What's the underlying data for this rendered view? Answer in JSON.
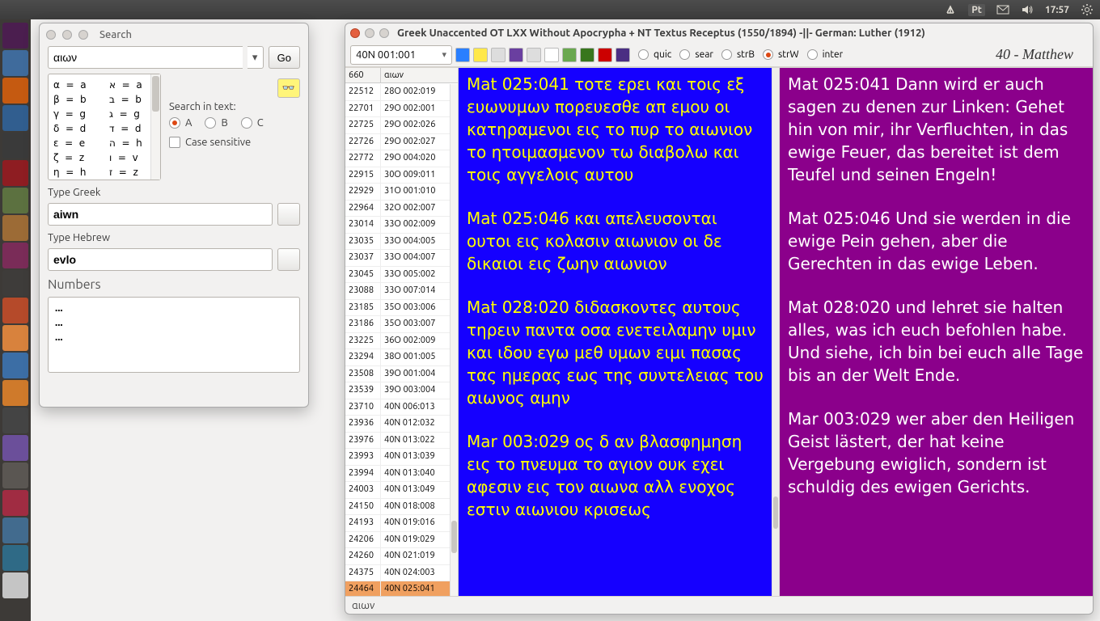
{
  "menubar": {
    "pt": "Pt",
    "time": "17:57"
  },
  "search_window": {
    "title": "Search",
    "query": "αιων",
    "go": "Go",
    "letters_left": "α  =  a\nβ  =  b\nγ  =  g\nδ  =  d\nε  =  e\nζ  =  z\nη  =  h",
    "letters_right": "א  =  a\nב  =  b\nג  =  g\nד  =  d\nה  =  h\nו  =  v\nז  =  z",
    "search_in_text": "Search in text:",
    "radio_a": "A",
    "radio_b": "B",
    "radio_c": "C",
    "case_sensitive": "Case sensitive",
    "type_greek": "Type Greek",
    "greek_value": "aiwn",
    "type_hebrew": "Type Hebrew",
    "hebrew_value": "evlo",
    "numbers_label": "Numbers",
    "numbers": [
      "...",
      "...",
      "..."
    ]
  },
  "main_window": {
    "title": "Greek Unaccented OT LXX Without Apocrypha + NT Textus Receptus (1550/1894)   -||-   German: Luther (1912)",
    "verse_selector": "40N 001:001",
    "radios": [
      {
        "label": "quic",
        "sel": false
      },
      {
        "label": "sear",
        "sel": false
      },
      {
        "label": "strB",
        "sel": false
      },
      {
        "label": "strW",
        "sel": true
      },
      {
        "label": "inter",
        "sel": false
      }
    ],
    "book": "40 - Matthew",
    "table_hdr_a": "660",
    "table_hdr_b": "αιων",
    "refs": [
      {
        "a": "22512",
        "b": "28O 002:019"
      },
      {
        "a": "22701",
        "b": "29O 002:001"
      },
      {
        "a": "22725",
        "b": "29O 002:026"
      },
      {
        "a": "22726",
        "b": "29O 002:027"
      },
      {
        "a": "22772",
        "b": "29O 004:020"
      },
      {
        "a": "22915",
        "b": "30O 009:011"
      },
      {
        "a": "22929",
        "b": "31O 001:010"
      },
      {
        "a": "22964",
        "b": "32O 002:007"
      },
      {
        "a": "23014",
        "b": "33O 002:009"
      },
      {
        "a": "23035",
        "b": "33O 004:005"
      },
      {
        "a": "23037",
        "b": "33O 004:007"
      },
      {
        "a": "23045",
        "b": "33O 005:002"
      },
      {
        "a": "23088",
        "b": "33O 007:014"
      },
      {
        "a": "23185",
        "b": "35O 003:006"
      },
      {
        "a": "23186",
        "b": "35O 003:007"
      },
      {
        "a": "23225",
        "b": "36O 002:009"
      },
      {
        "a": "23294",
        "b": "38O 001:005"
      },
      {
        "a": "23508",
        "b": "39O 001:004"
      },
      {
        "a": "23539",
        "b": "39O 003:004"
      },
      {
        "a": "23710",
        "b": "40N 006:013"
      },
      {
        "a": "23936",
        "b": "40N 012:032"
      },
      {
        "a": "23976",
        "b": "40N 013:022"
      },
      {
        "a": "23993",
        "b": "40N 013:039"
      },
      {
        "a": "23994",
        "b": "40N 013:040"
      },
      {
        "a": "24003",
        "b": "40N 013:049"
      },
      {
        "a": "24150",
        "b": "40N 018:008"
      },
      {
        "a": "24193",
        "b": "40N 019:016"
      },
      {
        "a": "24206",
        "b": "40N 019:029"
      },
      {
        "a": "24260",
        "b": "40N 021:019"
      },
      {
        "a": "24375",
        "b": "40N 024:003"
      },
      {
        "a": "24464",
        "b": "40N 025:041",
        "sel": true
      }
    ],
    "greek_verses": [
      {
        "ref": "Mat 025:041",
        "text": "τοτε ερει και τοις εξ ευωνυμων πορευεσθε απ εμου οι κατηραμενοι εις το πυρ το αιωνιον το ητοιμασμενον τω διαβολω και τοις αγγελοις αυτου"
      },
      {
        "ref": "Mat 025:046",
        "text": "και απελευσονται ουτοι εις κολασιν αιωνιον οι δε δικαιοι εις ζωην αιωνιον"
      },
      {
        "ref": "Mat 028:020",
        "text": "διδασκοντες αυτους τηρειν παντα οσα ενετειλαμην υμιν και ιδου εγω μεθ υμων ειμι πασας τας ημερας εως της συντελειας του αιωνος αμην"
      },
      {
        "ref": "Mar 003:029",
        "text": "ος δ αν βλασφημηση εις το πνευμα το αγιον ουκ εχει αφεσιν εις τον αιωνα αλλ ενοχος εστιν αιωνιου κρισεως"
      }
    ],
    "german_verses": [
      {
        "ref": "Mat 025:041",
        "text": "Dann wird er auch sagen zu denen zur Linken: Gehet hin von mir, ihr Verfluchten, in das ewige Feuer, das bereitet ist dem Teufel und seinen Engeln!"
      },
      {
        "ref": "Mat 025:046",
        "text": "Und sie werden in die ewige Pein gehen, aber die Gerechten in das ewige Leben."
      },
      {
        "ref": "Mat 028:020",
        "text": "und lehret sie halten alles, was ich euch befohlen habe. Und siehe, ich bin bei euch alle Tage bis an der Welt Ende."
      },
      {
        "ref": "Mar 003:029",
        "text": "wer aber den Heiligen Geist lästert, der hat keine Vergebung ewiglich, sondern ist schuldig des ewigen Gerichts."
      }
    ],
    "status": "αιων"
  }
}
